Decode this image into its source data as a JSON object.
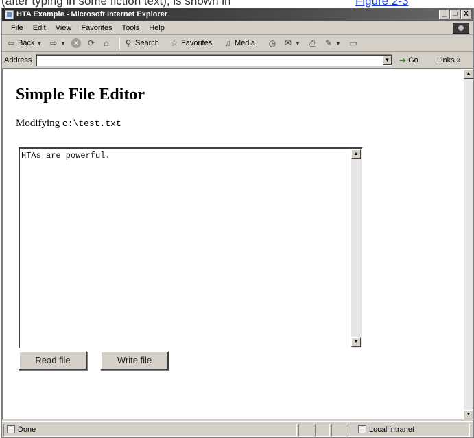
{
  "cutoff": {
    "text": "(after typing in some fiction text), is shown in",
    "link": "Figure 2-3"
  },
  "window": {
    "title": "HTA Example - Microsoft Internet Explorer",
    "controls": {
      "minimize": "_",
      "maximize": "□",
      "close": "X"
    }
  },
  "menu": {
    "items": [
      "File",
      "Edit",
      "View",
      "Favorites",
      "Tools",
      "Help"
    ]
  },
  "toolbar": {
    "back": "Back",
    "search": "Search",
    "favorites": "Favorites",
    "media": "Media"
  },
  "address": {
    "label": "Address",
    "value": "",
    "go": "Go",
    "links": "Links »"
  },
  "page": {
    "title": "Simple File Editor",
    "modifying_label": "Modifying",
    "file_path": "c:\\test.txt",
    "editor_text": "HTAs are powerful.",
    "read_button": "Read file",
    "write_button": "Write file"
  },
  "status": {
    "text": "Done",
    "zone": "Local intranet"
  }
}
